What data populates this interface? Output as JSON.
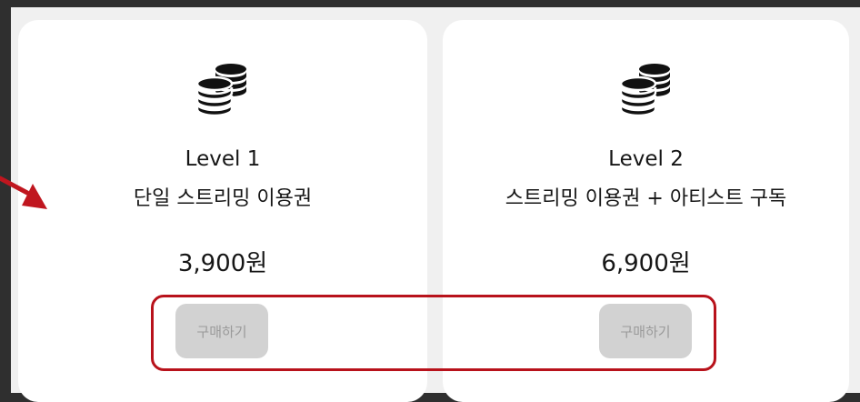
{
  "plans": [
    {
      "icon": "coins-stack-icon",
      "level": "Level 1",
      "description": "단일 스트리밍 이용권",
      "price": "3,900원",
      "button_label": "구매하기"
    },
    {
      "icon": "coins-stack-icon",
      "level": "Level 2",
      "description": "스트리밍 이용권 + 아티스트 구독",
      "price": "6,900원",
      "button_label": "구매하기"
    }
  ],
  "annotation": {
    "highlight_color": "#b8121b",
    "arrow_color": "#c0161f"
  },
  "colors": {
    "card_background": "#ffffff",
    "button_background": "#d2d2d2",
    "button_text": "#9a9a9a",
    "text": "#161616"
  }
}
